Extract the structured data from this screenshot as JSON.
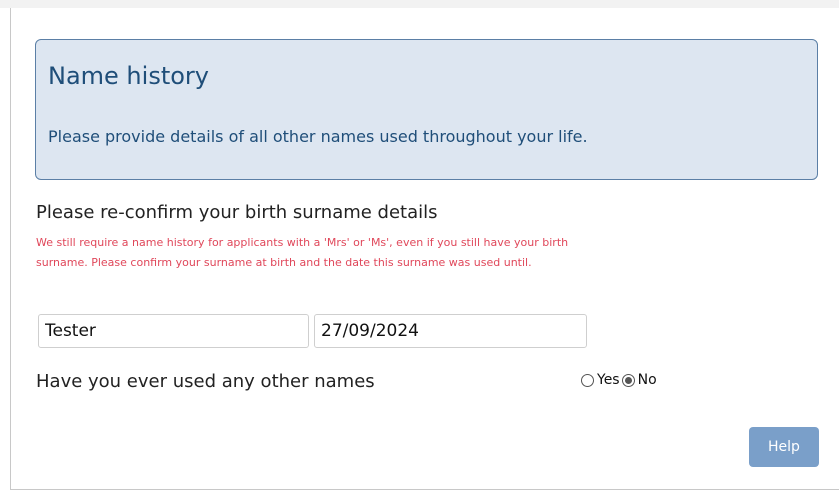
{
  "info_box": {
    "title": "Name history",
    "text": "Please provide details of all other names used throughout your life."
  },
  "birth_surname": {
    "heading": "Please re-confirm your birth surname details",
    "warning": "We still require a name history for applicants with a 'Mrs' or 'Ms', even if you still have your birth surname. Please confirm your surname at birth and the date this surname was used until.",
    "surname_value": "Tester",
    "date_value": "27/09/2024"
  },
  "other_names": {
    "question": "Have you ever used any other names",
    "options": [
      {
        "label": "Yes",
        "selected": false
      },
      {
        "label": "No",
        "selected": true
      }
    ]
  },
  "help_button": {
    "label": "Help",
    "color": "#7a9fc9"
  },
  "colors": {
    "info_background": "#dde6f1",
    "info_border": "#5b7fa6",
    "heading_text": "#1f4e79",
    "warning_text": "#e0475a"
  }
}
